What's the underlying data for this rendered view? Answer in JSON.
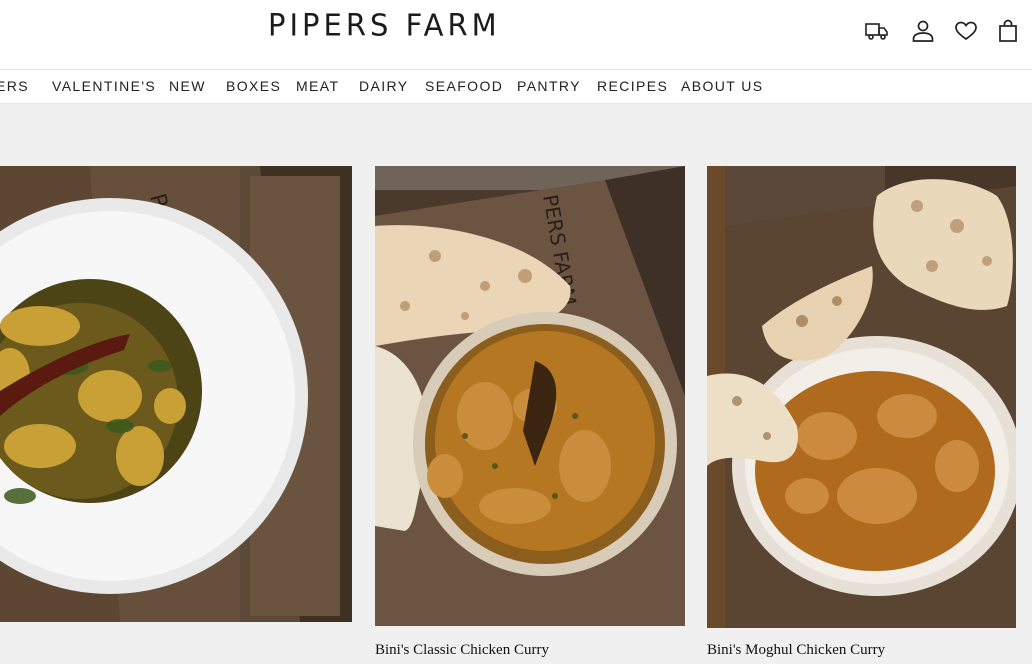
{
  "header": {
    "logo": "PIPERS FARM",
    "icons": [
      "delivery-truck-icon",
      "account-icon",
      "wishlist-heart-icon",
      "shopping-bag-icon"
    ]
  },
  "nav": {
    "items": [
      {
        "label": "ERS"
      },
      {
        "label": "VALENTINE'S"
      },
      {
        "label": "NEW"
      },
      {
        "label": "BOXES"
      },
      {
        "label": "MEAT"
      },
      {
        "label": "DAIRY"
      },
      {
        "label": "SEAFOOD"
      },
      {
        "label": "PANTRY"
      },
      {
        "label": "RECIPES"
      },
      {
        "label": "ABOUT US"
      }
    ]
  },
  "recipes": [
    {
      "title": ""
    },
    {
      "title": "Bini's Classic Chicken Curry"
    },
    {
      "title": "Bini's Moghul Chicken Curry"
    }
  ],
  "colors": {
    "page_bg": "#f0f0f0",
    "header_bg": "#ffffff",
    "wood": "#5a4634",
    "curry": "#b8741f"
  }
}
